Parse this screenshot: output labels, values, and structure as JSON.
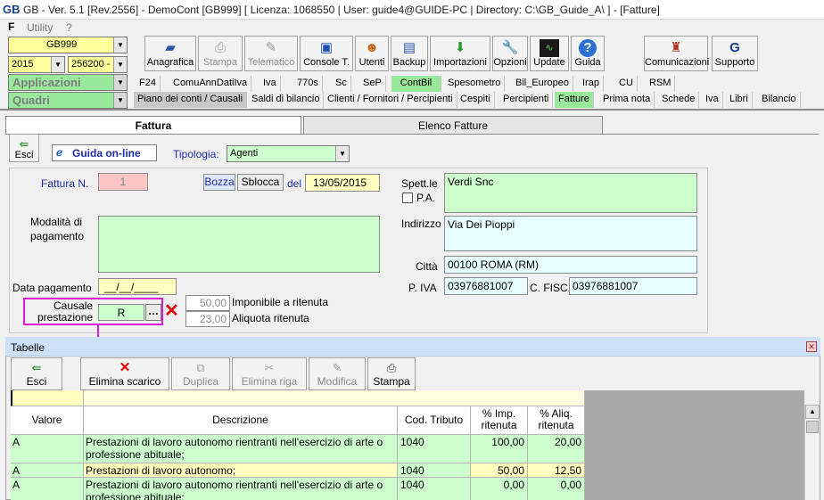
{
  "window": {
    "title": "GB - Ver. 5.1 [Rev.2556] - DemoCont [GB999]   [ Licenza: 1068550 | User: guide4@GUIDE-PC | Directory: C:\\GB_Guide_A\\ ] - [Fatture]",
    "app_icon": "GB"
  },
  "menubar": {
    "logo": "F",
    "items": [
      "Utility",
      "?"
    ]
  },
  "selectors": {
    "company": "GB999",
    "year": "2015",
    "code": "256200 -",
    "applicazioni": "Applicazioni",
    "quadri": "Quadri"
  },
  "toolbar": [
    {
      "label": "Anagrafica",
      "icon": "notebook-icon",
      "enabled": true
    },
    {
      "label": "Stampa",
      "icon": "printer-icon",
      "enabled": false
    },
    {
      "label": "Telematico",
      "icon": "telematico-icon",
      "enabled": false
    },
    {
      "label": "Console T.",
      "icon": "console-icon",
      "enabled": true
    },
    {
      "label": "Utenti",
      "icon": "users-icon",
      "enabled": true
    },
    {
      "label": "Backup",
      "icon": "backup-icon",
      "enabled": true
    },
    {
      "label": "Importazioni",
      "icon": "import-icon",
      "enabled": true
    },
    {
      "label": "Opzioni",
      "icon": "wrench-icon",
      "enabled": true
    },
    {
      "label": "Update",
      "icon": "update-icon",
      "enabled": true
    },
    {
      "label": "Guida",
      "icon": "help-icon",
      "enabled": true
    },
    {
      "label": "Comunicazioni",
      "icon": "comunicazioni-icon",
      "enabled": true
    },
    {
      "label": "Supporto",
      "icon": "supporto-icon",
      "enabled": true
    }
  ],
  "module_tabs": [
    "F24",
    "ComuAnnDatiIva",
    "Iva",
    "770s",
    "Sc",
    "SeP",
    "ContBil",
    "Spesometro",
    "Bil_Europeo",
    "Irap",
    "CU",
    "RSM"
  ],
  "module_active": "ContBil",
  "page_tabs": [
    "Piano dei conti / Causali",
    "Saldi di bilancio",
    "Clienti / Fornitori / Percipienti",
    "Cespiti",
    "Percipienti",
    "Fatture",
    "Prima nota",
    "Schede",
    "Iva",
    "Libri",
    "Bilancio"
  ],
  "page_active": "Fatture",
  "form_tabs": {
    "fattura": "Fattura",
    "elenco": "Elenco Fatture"
  },
  "form": {
    "esci": "Esci",
    "guida_online": "Guida on-line",
    "tipologia_label": "Tipologia:",
    "tipologia_value": "Agenti",
    "fattura_n_label": "Fattura N.",
    "fattura_n_value": "1",
    "bozza": "Bozza",
    "sblocca": "Sblocca",
    "del_label": "del",
    "date_value": "13/05/2015",
    "modalita_label_1": "Modalità di",
    "modalita_label_2": "pagamento",
    "data_pagamento_label": "Data pagamento",
    "data_pagamento_value": "__/__/____",
    "causale_label_1": "Causale",
    "causale_label_2": "prestazione",
    "causale_value": "R",
    "imponibile_value": "50,00",
    "imponibile_label": "Imponibile a ritenuta",
    "aliquota_value": "23,00",
    "aliquota_label": "Aliquota ritenuta",
    "spett_label": "Spett.le",
    "spett_value": "Verdi Snc",
    "pa_label": "P.A.",
    "indirizzo_label": "Indirizzo",
    "indirizzo_value": "Via Dei Pioppi",
    "citta_label": "Città",
    "citta_value": "00100  ROMA (RM)",
    "piva_label": "P. IVA",
    "piva_value": "03976881007",
    "cfisc_label": "C. FISC.",
    "cfisc_value": "03976881007"
  },
  "tabelle": {
    "title": "Tabelle",
    "buttons": [
      {
        "label": "Esci",
        "icon": "exit-icon",
        "enabled": true
      },
      {
        "label": "Elimina scarico",
        "icon": "red-x-icon",
        "enabled": true
      },
      {
        "label": "Duplica",
        "icon": "duplicate-icon",
        "enabled": false
      },
      {
        "label": "Elimina riga",
        "icon": "delete-row-icon",
        "enabled": false
      },
      {
        "label": "Modifica",
        "icon": "edit-icon",
        "enabled": false
      },
      {
        "label": "Stampa",
        "icon": "printer-icon",
        "enabled": true
      }
    ],
    "columns": [
      "Valore",
      "Descrizione",
      "Cod. Tributo",
      "% Imp. ritenuta",
      "% Aliq. ritenuta"
    ],
    "rows": [
      {
        "valore": "A",
        "descrizione": "Prestazioni di lavoro autonomo rientranti nell'esercizio di arte o professione abituale;",
        "cod": "1040",
        "imp": "100,00",
        "aliq": "20,00",
        "style": "green"
      },
      {
        "valore": "A",
        "descrizione": "Prestazioni di lavoro autonomo;",
        "cod": "1040",
        "imp": "50,00",
        "aliq": "12,50",
        "style": "yellow"
      },
      {
        "valore": "A",
        "descrizione": "Prestazioni di lavoro autonomo rientranti nell'esercizio di arte o professione abituale;",
        "cod": "1040",
        "imp": "0,00",
        "aliq": "0,00",
        "style": "green"
      }
    ]
  },
  "colors": {
    "green": "#99e89b",
    "light_green": "#ccffcc",
    "yellow": "#ffffc0",
    "magenta": "#e01bd6",
    "red": "#e00000"
  }
}
